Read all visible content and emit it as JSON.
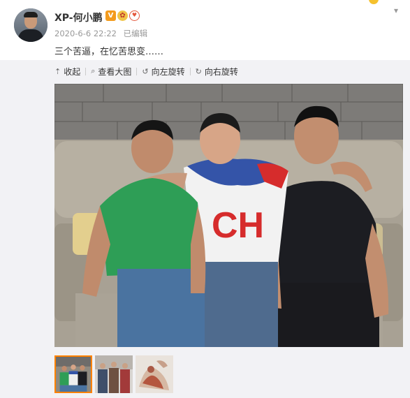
{
  "post": {
    "author": "XP-何小鹏",
    "badges": {
      "verified": "V",
      "member_icon_1": "member-badge-icon",
      "member_icon_2": "gift-badge-icon"
    },
    "time": "2020-6-6 22:22",
    "edited": "已编辑",
    "text": "三个苦逼，在忆苦思变……"
  },
  "toolbar": {
    "collapse": "收起",
    "view_large": "查看大图",
    "rotate_left": "向左旋转",
    "rotate_right": "向右旋转",
    "icons": {
      "collapse": "arrow-up-icon",
      "view_large": "magnifier-icon",
      "rotate_left": "rotate-left-icon",
      "rotate_right": "rotate-right-icon"
    }
  },
  "gallery": {
    "photo_count": 3,
    "selected_index": 0
  },
  "colors": {
    "accent": "#ff8200",
    "verified": "#f39b1d",
    "meta_text": "#999999"
  }
}
